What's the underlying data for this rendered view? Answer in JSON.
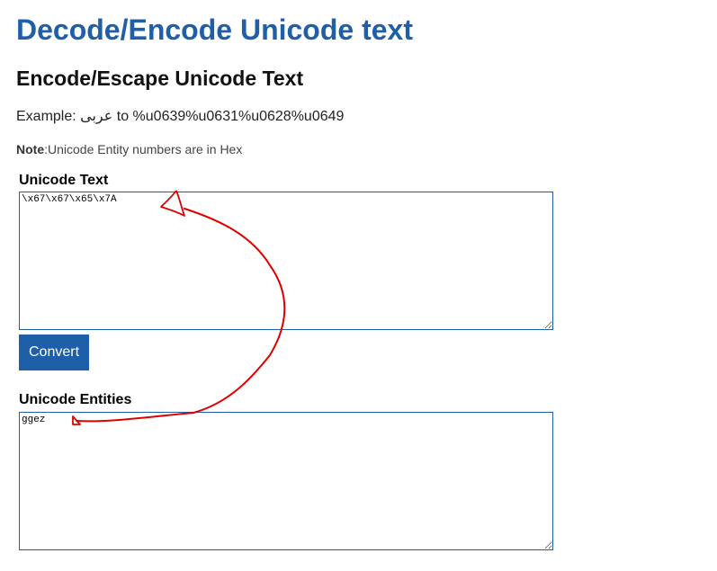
{
  "header": {
    "title": "Decode/Encode Unicode text",
    "subtitle": "Encode/Escape Unicode Text"
  },
  "example": {
    "prefix": "Example: ",
    "arabic": "عربى",
    "middle": " to ",
    "encoded": "%u0639%u0631%u0628%u0649"
  },
  "note": {
    "bold": "Note",
    "text": ":Unicode Entity numbers are in Hex"
  },
  "input": {
    "label": "Unicode Text",
    "value": "\\x67\\x67\\x65\\x7A"
  },
  "convert_button": {
    "label": "Convert"
  },
  "output": {
    "label": "Unicode Entities",
    "value": "ggez"
  },
  "colors": {
    "accent": "#1f5fa8",
    "annotation": "#e00000"
  }
}
